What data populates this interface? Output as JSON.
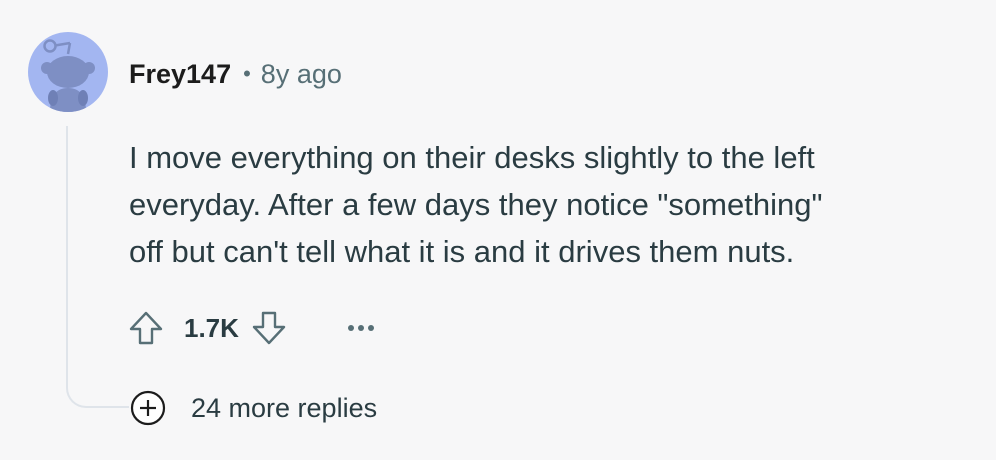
{
  "comment": {
    "author": "Frey147",
    "separator": "•",
    "age": "8y ago",
    "body_lines": [
      "I move everything on their desks slightly to the left",
      "everyday. After a few days they notice \"something\"",
      "off but can't tell what it is and it drives them nuts."
    ],
    "vote_count": "1.7K",
    "more_replies_label": "24 more replies"
  },
  "icons": {
    "avatar": "reddit-snoo-avatar",
    "upvote": "upvote-arrow-icon",
    "downvote": "downvote-arrow-icon",
    "more": "ellipsis-icon",
    "expand": "plus-circle-icon"
  },
  "colors": {
    "background": "#f7f7f8",
    "avatar_bg": "#a3b6f1",
    "avatar_figure": "#7e8fc4",
    "text": "#2a3c42",
    "muted": "#576f76",
    "thread_line": "#dfe4ea"
  }
}
